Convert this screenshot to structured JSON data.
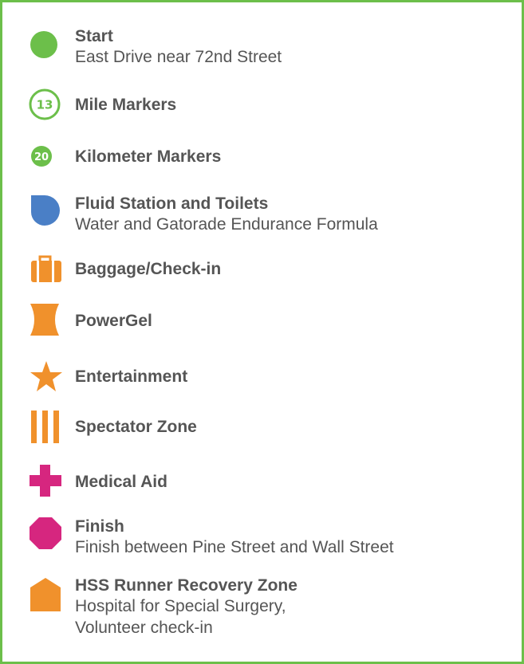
{
  "legend": {
    "items": [
      {
        "icon": "green-circle-icon",
        "title": "Start",
        "subtitle": "East Drive near 72nd Street"
      },
      {
        "icon": "mile-marker-icon",
        "icon_text": "13",
        "title": "Mile Markers"
      },
      {
        "icon": "kilometer-marker-icon",
        "icon_text": "20",
        "title": "Kilometer Markers"
      },
      {
        "icon": "fluid-station-icon",
        "title": "Fluid Station and Toilets",
        "subtitle": "Water and Gatorade Endurance Formula"
      },
      {
        "icon": "baggage-icon",
        "title": "Baggage/Check-in"
      },
      {
        "icon": "powergel-icon",
        "title": "PowerGel"
      },
      {
        "icon": "star-icon",
        "title": "Entertainment"
      },
      {
        "icon": "spectator-zone-icon",
        "title": "Spectator Zone"
      },
      {
        "icon": "medical-cross-icon",
        "title": "Medical Aid"
      },
      {
        "icon": "finish-octagon-icon",
        "title": "Finish",
        "subtitle": "Finish between Pine Street and Wall Street"
      },
      {
        "icon": "recovery-zone-icon",
        "title": "HSS Runner Recovery Zone",
        "subtitle": "Hospital for Special Surgery,\nVolunteer check-in"
      }
    ]
  },
  "colors": {
    "border": "#6cbf4a",
    "green": "#6cbf4a",
    "blue": "#4a7fc6",
    "orange": "#f0912c",
    "magenta": "#d6267f",
    "text": "#555555"
  }
}
